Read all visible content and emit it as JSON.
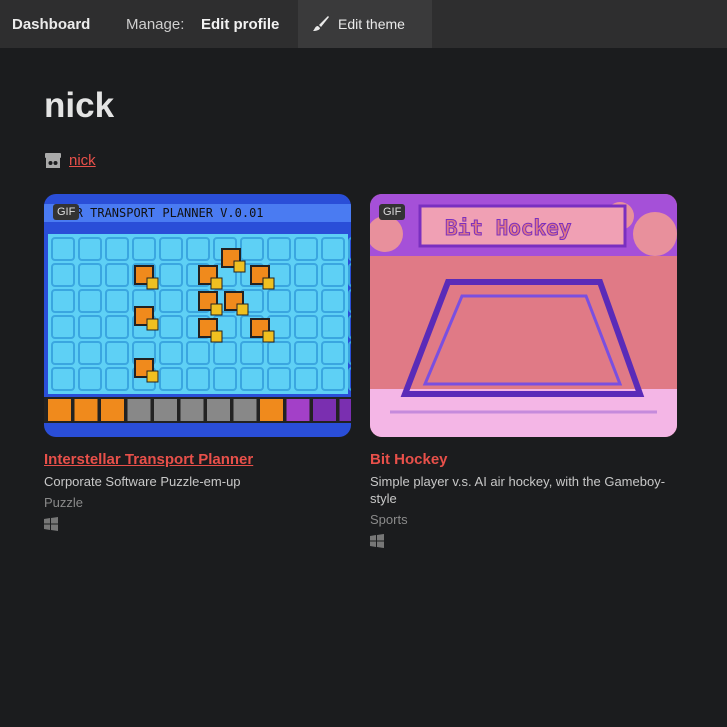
{
  "topbar": {
    "dashboard": "Dashboard",
    "manage": "Manage:",
    "edit_profile": "Edit profile",
    "edit_theme": "Edit theme"
  },
  "profile": {
    "heading": "nick",
    "username": "nick"
  },
  "games": [
    {
      "title": "Interstellar Transport Planner",
      "thumb_text": "LLAR TRANSPORT PLANNER  V.0.01",
      "badge": "GIF",
      "description": "Corporate Software Puzzle-em-up",
      "genre": "Puzzle",
      "platform_icon": "windows-icon"
    },
    {
      "title": "Bit Hockey",
      "thumb_text": "Bit Hockey",
      "badge": "GIF",
      "description": "Simple player v.s. AI air hockey, with the Gameboy-style",
      "genre": "Sports",
      "platform_icon": "windows-icon"
    }
  ],
  "colors": {
    "background": "#1b1c1e",
    "topbar": "#2e2e2f",
    "link": "#e8504a"
  }
}
